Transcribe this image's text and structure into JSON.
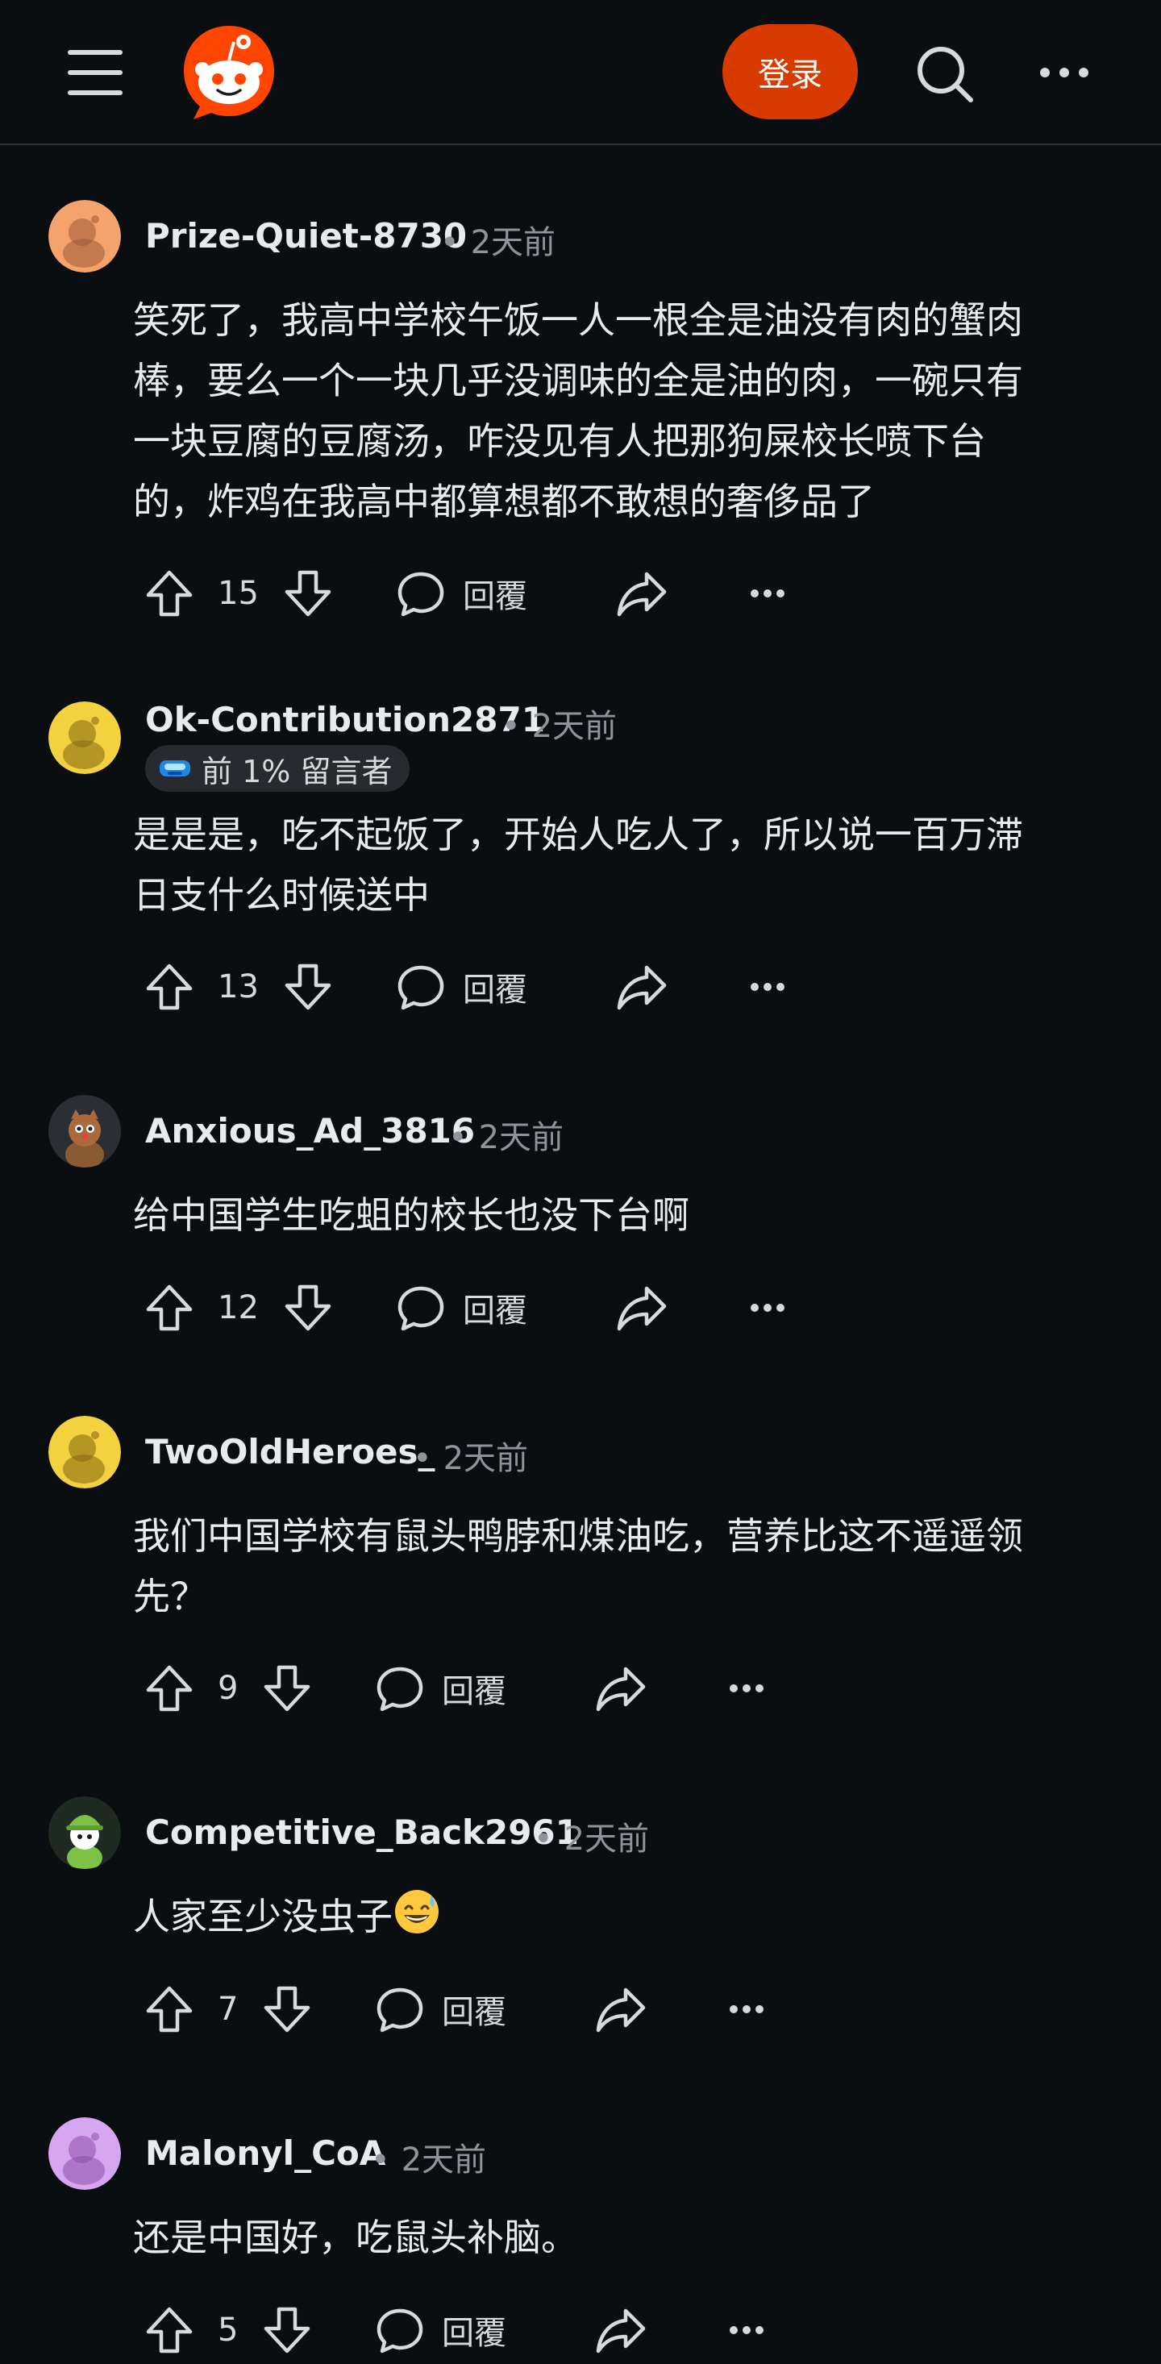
{
  "header": {
    "login_label": "登录"
  },
  "comments": [
    {
      "author": "Prize-Quiet-8730",
      "time": "2天前",
      "text_lines": [
        "笑死了，我高中学校午饭一人一根全是油没有肉的蟹肉",
        "棒，要么一个一块几乎没调味的全是油的肉，一碗只有",
        "一块豆腐的豆腐汤，咋没见有人把那狗屎校长喷下台",
        "的，炸鸡在我高中都算想都不敢想的奢侈品了"
      ],
      "votes": "15",
      "reply_label": "回覆",
      "avatar_color": "#f3a36b"
    },
    {
      "author": "Ok-Contribution2871",
      "time": "2天前",
      "flair": "前 1% 留言者",
      "text_lines": [
        "是是是，吃不起饭了，开始人吃人了，所以说一百万滞",
        "日支什么时候送中"
      ],
      "votes": "13",
      "reply_label": "回覆",
      "avatar_color": "#f4d23f"
    },
    {
      "author": "Anxious_Ad_3816",
      "time": "2天前",
      "text_lines": [
        "给中国学生吃蛆的校长也没下台啊"
      ],
      "votes": "12",
      "reply_label": "回覆",
      "avatar_color": "#2b2f33"
    },
    {
      "author": "TwoOldHeroes_",
      "time": "2天前",
      "text_lines": [
        "我们中国学校有鼠头鸭脖和煤油吃，营养比这不遥遥领",
        "先？"
      ],
      "votes": "9",
      "reply_label": "回覆",
      "avatar_color": "#f4d23f"
    },
    {
      "author": "Competitive_Back2961",
      "time": "2天前",
      "text_lines": [
        "人家至少没虫子"
      ],
      "votes": "7",
      "reply_label": "回覆",
      "avatar_color": "#1f2a22"
    },
    {
      "author": "Malonyl_CoA",
      "time": "2天前",
      "text_lines": [
        "还是中国好，吃鼠头补脑。"
      ],
      "votes": "5",
      "reply_label": "回覆",
      "avatar_color": "#d7a6f0"
    }
  ],
  "colors": {
    "background": "#0b0e11",
    "brand": "#ff4500",
    "login_button": "#d93a00",
    "meta_text": "#8e949b"
  },
  "icons": [
    "menu-icon",
    "reddit-logo",
    "search-icon",
    "more-icon",
    "upvote-icon",
    "downvote-icon",
    "reply-icon",
    "share-icon",
    "more-options-icon",
    "award-icon",
    "grinning-sweat-emoji"
  ]
}
